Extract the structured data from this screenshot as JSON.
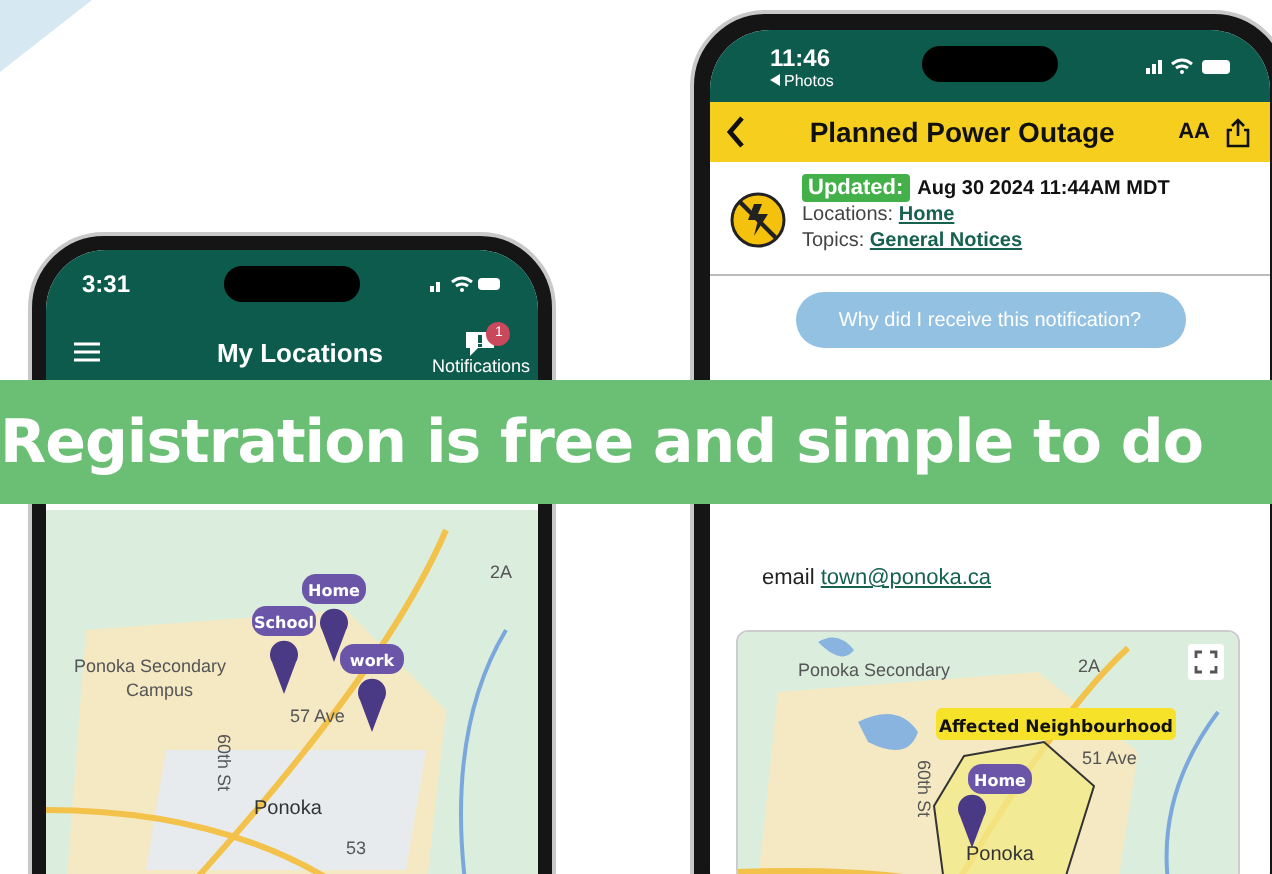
{
  "left_phone": {
    "time": "3:31",
    "title": "My Locations",
    "notifications": {
      "label": "Notifications",
      "badge": "1"
    },
    "map": {
      "labels": [
        "Ponoka Secondary",
        "Campus",
        "57 Ave",
        "60th St",
        "Ponoka",
        "2A",
        "53"
      ],
      "pins": [
        {
          "label": "Home"
        },
        {
          "label": "School"
        },
        {
          "label": "work"
        }
      ]
    }
  },
  "banner": {
    "text": "Registration is free and simple to do"
  },
  "right_phone": {
    "time": "11:46",
    "back_app": "Photos",
    "title": "Planned Power Outage",
    "text_size": "AA",
    "updated_label": "Updated:",
    "updated_time": "Aug 30 2024 11:44AM MDT",
    "locations_label": "Locations:",
    "location": "Home",
    "topics_label": "Topics:",
    "topic": "General Notices",
    "why_button": "Why did I receive this notification?",
    "email_label": "email",
    "email": "town@ponoka.ca",
    "map": {
      "labels": [
        "Ponoka Secondary",
        "2A",
        "51 Ave",
        "60th St",
        "Ponoka"
      ],
      "area_label": "Affected Neighbourhood",
      "pins": [
        {
          "label": "Home"
        }
      ]
    }
  }
}
